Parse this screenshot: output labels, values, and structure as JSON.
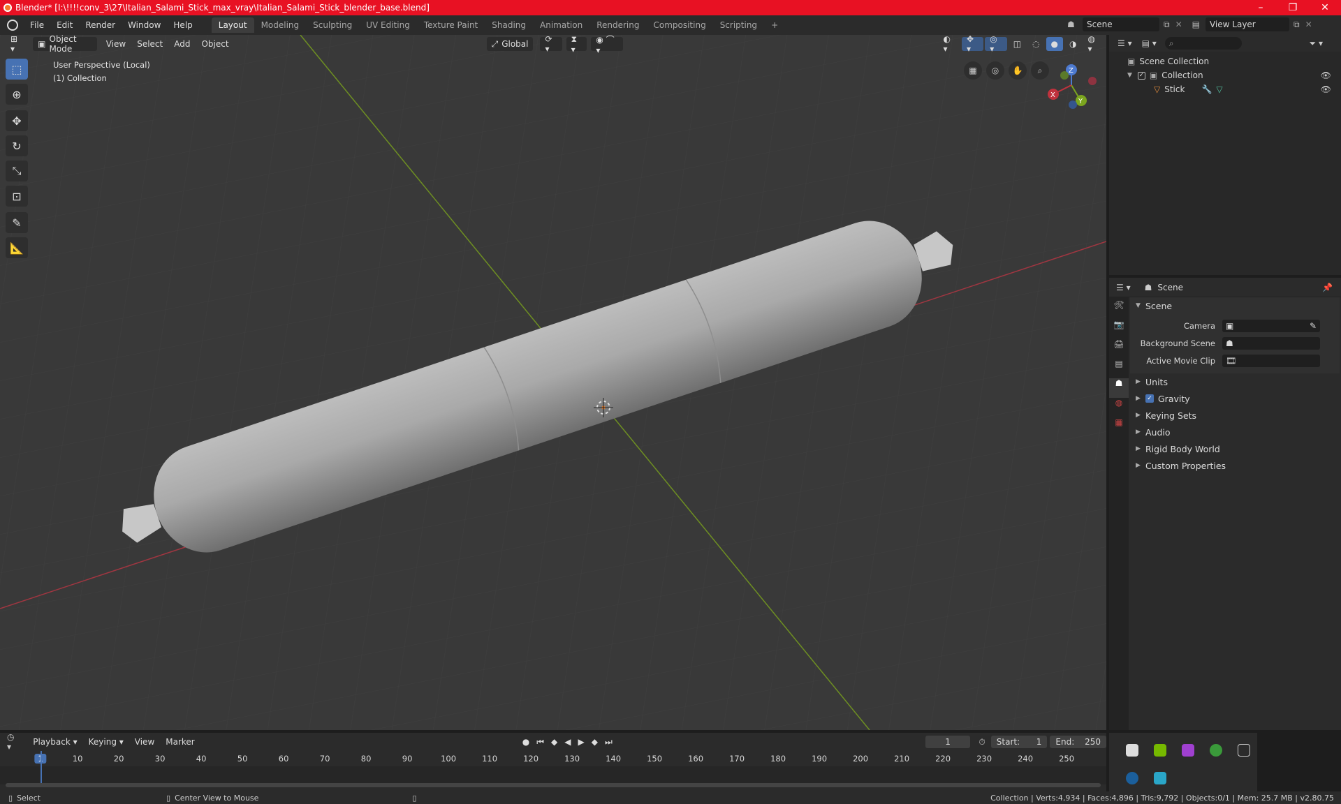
{
  "titlebar": {
    "title": "Blender* [I:\\!!!!conv_3\\27\\Italian_Salami_Stick_max_vray\\Italian_Salami_Stick_blender_base.blend]",
    "minimize": "–",
    "maximize": "❐",
    "close": "✕"
  },
  "menu": [
    "File",
    "Edit",
    "Render",
    "Window",
    "Help"
  ],
  "workspaces": [
    "Layout",
    "Modeling",
    "Sculpting",
    "UV Editing",
    "Texture Paint",
    "Shading",
    "Animation",
    "Rendering",
    "Compositing",
    "Scripting"
  ],
  "workspace_add": "+",
  "scene_selector": "Scene",
  "view_layer": "View Layer",
  "viewport": {
    "mode": "Object Mode",
    "menus": [
      "View",
      "Select",
      "Add",
      "Object"
    ],
    "transform_orientation": "Global",
    "perspective_label": "User Perspective (Local)",
    "collection_label": "(1) Collection",
    "gizmo": {
      "x": "X",
      "y": "Y",
      "z": "Z"
    }
  },
  "outliner": {
    "root": "Scene Collection",
    "collection": "Collection",
    "object": "Stick"
  },
  "properties": {
    "header": "Scene",
    "panel": "Scene",
    "fields": [
      {
        "label": "Camera"
      },
      {
        "label": "Background Scene"
      },
      {
        "label": "Active Movie Clip"
      }
    ],
    "sections": [
      "Units",
      "Gravity",
      "Keying Sets",
      "Audio",
      "Rigid Body World",
      "Custom Properties"
    ],
    "gravity_enabled": true
  },
  "timeline": {
    "menus": [
      "Playback",
      "Keying",
      "View",
      "Marker"
    ],
    "current_frame": "1",
    "start_label": "Start:",
    "start": "1",
    "end_label": "End:",
    "end": "250",
    "ticks": [
      "1",
      "10",
      "20",
      "30",
      "40",
      "50",
      "60",
      "70",
      "80",
      "90",
      "100",
      "110",
      "120",
      "130",
      "140",
      "150",
      "160",
      "170",
      "180",
      "190",
      "200",
      "210",
      "220",
      "230",
      "240",
      "250"
    ]
  },
  "statusbar": {
    "select": "Select",
    "center": "Center View to Mouse",
    "stats": "Collection | Verts:4,934 | Faces:4,896 | Tris:9,792 | Objects:0/1 | Mem: 25.7 MB | v2.80.75"
  },
  "colors": {
    "accent": "#4772b3",
    "x_axis": "#c0323d",
    "y_axis": "#7ba51e",
    "title_bar": "#e81123"
  }
}
